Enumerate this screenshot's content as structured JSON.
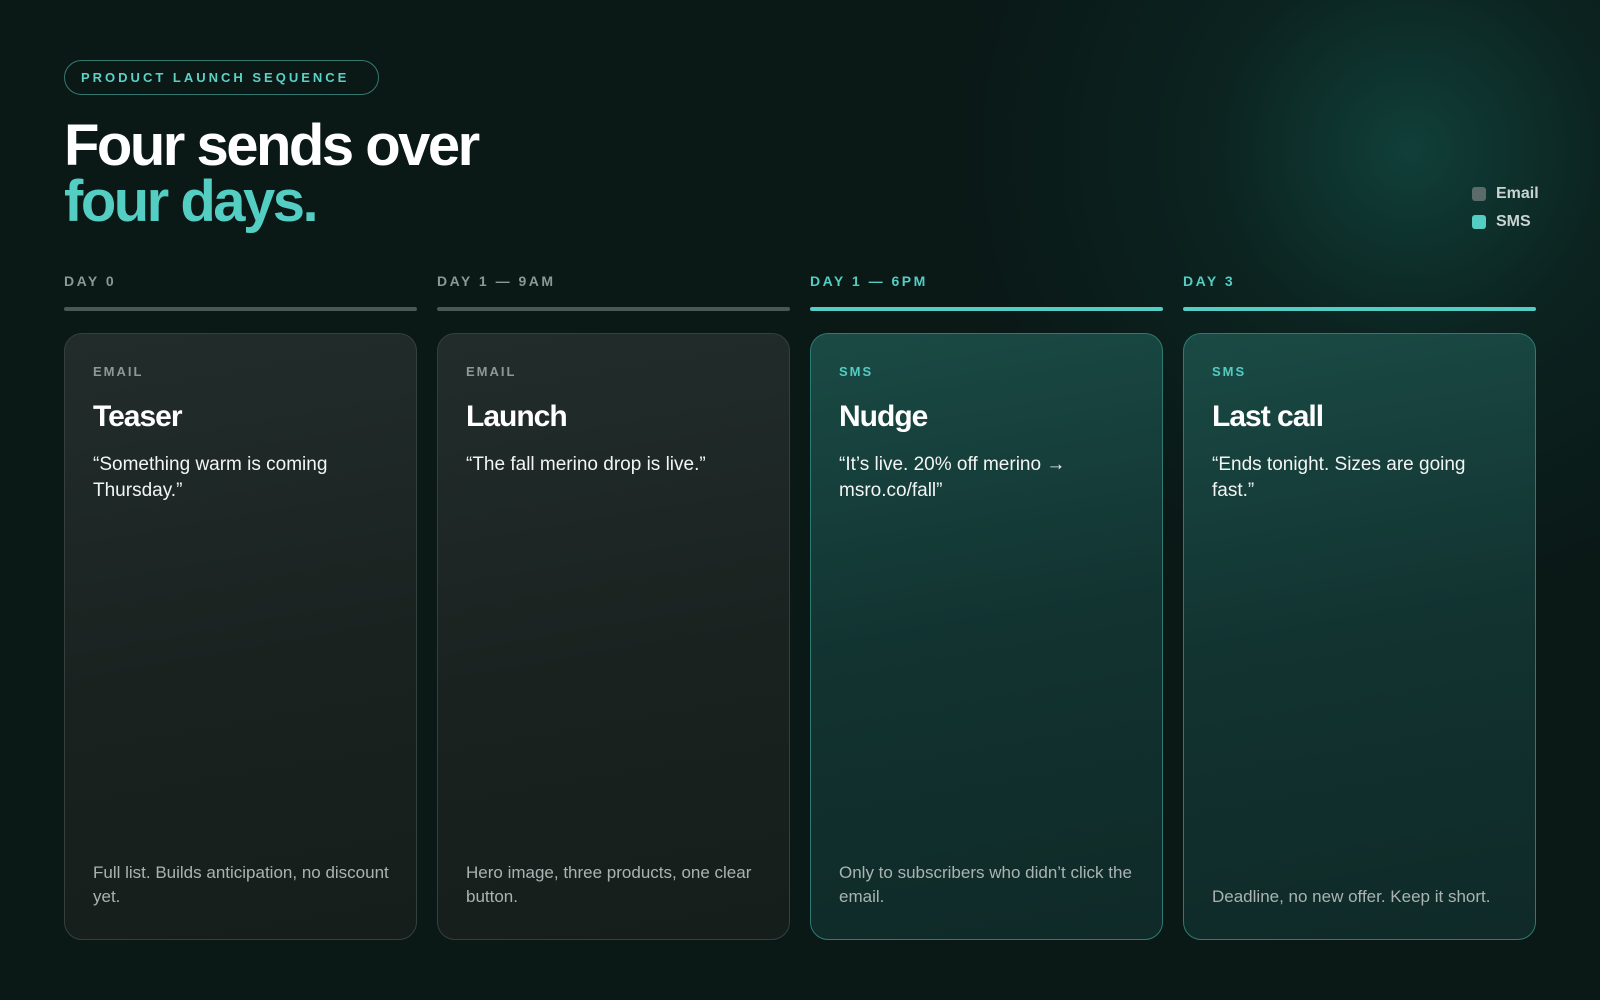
{
  "header": {
    "eyebrow": "PRODUCT LAUNCH SEQUENCE",
    "title_line1": "Four sends over",
    "title_line2": "four days."
  },
  "legend": {
    "items": [
      {
        "label": "Email",
        "color": "#5b6b69"
      },
      {
        "label": "SMS",
        "color": "#54cdc3"
      }
    ]
  },
  "colors": {
    "accent": "#54cdc3",
    "email_muted": "#5b6b69",
    "background": "#0a1816"
  },
  "sends": [
    {
      "day": "DAY 0",
      "channel": "EMAIL",
      "title": "Teaser",
      "quote": "“Something warm is coming Thursday.”",
      "note": "Full list. Builds anticipation, no discount yet."
    },
    {
      "day": "DAY 1 — 9AM",
      "channel": "EMAIL",
      "title": "Launch",
      "quote": "“The fall merino drop is live.”",
      "note": "Hero image, three products, one clear button."
    },
    {
      "day": "DAY 1 — 6PM",
      "channel": "SMS",
      "title": "Nudge",
      "quote": "“It’s live. 20% off merino → msro.co/fall”",
      "note": "Only to subscribers who didn’t click the email."
    },
    {
      "day": "DAY 3",
      "channel": "SMS",
      "title": "Last call",
      "quote": "“Ends tonight. Sizes are going fast.”",
      "note": "Deadline, no new offer. Keep it short."
    }
  ]
}
